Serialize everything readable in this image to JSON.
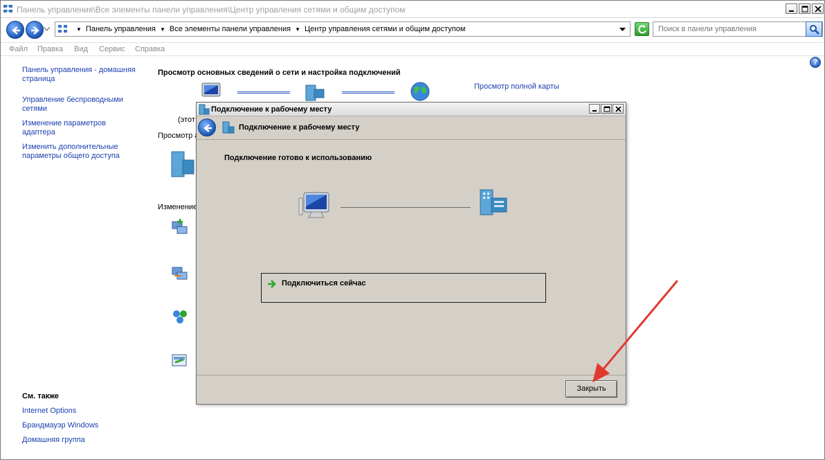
{
  "window": {
    "title": "Панель управления\\Все элементы панели управления\\Центр управления сетями и общим доступом"
  },
  "address": {
    "crumbs": [
      "Панель управления",
      "Все элементы панели управления",
      "Центр управления сетями и общим доступом"
    ]
  },
  "search": {
    "placeholder": "Поиск в панели управления"
  },
  "menu": [
    "Файл",
    "Правка",
    "Вид",
    "Сервис",
    "Справка"
  ],
  "sidebar": {
    "links": [
      "Панель управления - домашняя страница",
      "Управление беспроводными сетями",
      "Изменение параметров адаптера",
      "Изменить дополнительные параметры общего доступа"
    ],
    "see_also_title": "См. также",
    "see_also": [
      "Internet Options",
      "Брандмауэр Windows",
      "Домашняя группа"
    ]
  },
  "main": {
    "heading": "Просмотр основных сведений о сети и настройка подключений",
    "full_map_link": "Просмотр полной карты",
    "partial_this": "(этот",
    "partial_view": "Просмотр а",
    "partial_change": "Изменение"
  },
  "dialog": {
    "title": "Подключение к рабочему месту",
    "header": "Подключение к рабочему месту",
    "status": "Подключение готово к использованию",
    "connect_now": "Подключиться сейчас",
    "close_button": "Закрыть"
  },
  "annotation": {
    "arrow_color": "#e03a2f"
  }
}
